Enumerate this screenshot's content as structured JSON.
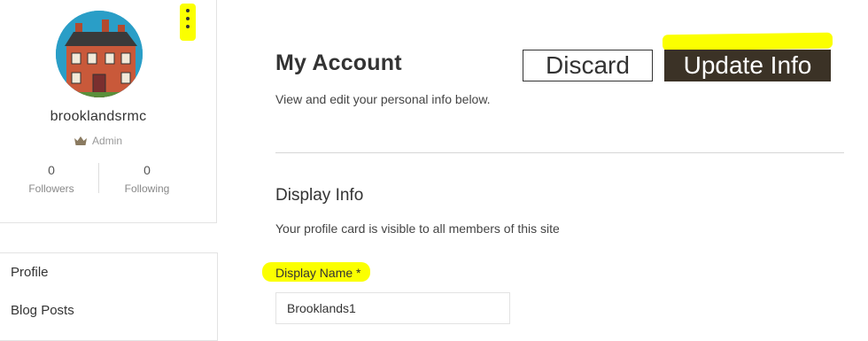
{
  "profile": {
    "username": "brooklandsrmc",
    "role": "Admin",
    "followers": {
      "count": "0",
      "label": "Followers"
    },
    "following": {
      "count": "0",
      "label": "Following"
    }
  },
  "nav": {
    "items": [
      {
        "label": "Profile"
      },
      {
        "label": "Blog Posts"
      }
    ]
  },
  "main": {
    "title": "My Account",
    "subtitle": "View and edit your personal info below.",
    "discard_label": "Discard",
    "update_label": "Update Info",
    "section_title": "Display Info",
    "section_desc": "Your profile card is visible to all members of this site",
    "display_name_label": "Display Name *",
    "display_name_value": "Brooklands1"
  },
  "colors": {
    "highlight": "#fbff00",
    "update_button_bg": "#3b3226",
    "avatar_bg": "#2a9ec7"
  }
}
